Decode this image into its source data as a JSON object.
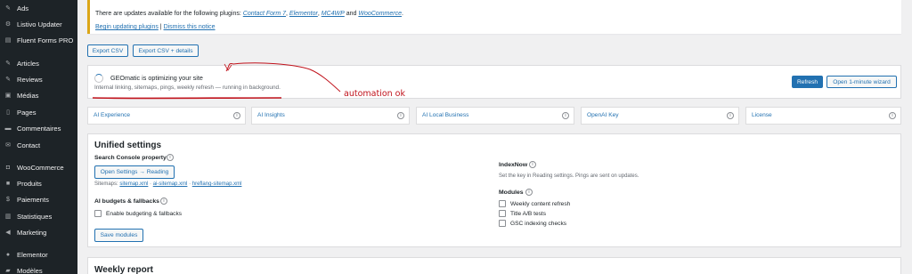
{
  "sidebar": {
    "items": [
      {
        "label": "Ads",
        "icon": "pin-icon"
      },
      {
        "label": "Listivo Updater",
        "icon": "gear-icon"
      },
      {
        "label": "Fluent Forms PRO",
        "icon": "forms-icon"
      },
      {
        "label": "Articles",
        "icon": "pin-icon"
      },
      {
        "label": "Reviews",
        "icon": "pin-icon"
      },
      {
        "label": "Médias",
        "icon": "media-icon"
      },
      {
        "label": "Pages",
        "icon": "page-icon"
      },
      {
        "label": "Commentaires",
        "icon": "comment-icon"
      },
      {
        "label": "Contact",
        "icon": "mail-icon"
      },
      {
        "label": "WooCommerce",
        "icon": "woo-icon"
      },
      {
        "label": "Produits",
        "icon": "box-icon"
      },
      {
        "label": "Paiements",
        "icon": "dollar-icon"
      },
      {
        "label": "Statistiques",
        "icon": "chart-icon"
      },
      {
        "label": "Marketing",
        "icon": "megaphone-icon"
      },
      {
        "label": "Elementor",
        "icon": "elementor-icon"
      },
      {
        "label": "Modèles",
        "icon": "folder-icon"
      }
    ]
  },
  "notice": {
    "text_prefix": "There are updates available for the following plugins: ",
    "plugins": [
      "Contact Form 7",
      "Elementor",
      "MC4WP",
      "WooCommerce"
    ],
    "sep1": ", ",
    "and": " and ",
    "period": ".",
    "begin_link": "Begin updating plugins",
    "pipe": " | ",
    "dismiss_link": "Dismiss this notice"
  },
  "export": {
    "csv_label": "Export CSV",
    "csv_details_label": "Export CSV + details"
  },
  "status": {
    "title": "GEOmatic is optimizing your site",
    "subtitle": "Internal linking, sitemaps, pings, weekly refresh — running in background.",
    "refresh_label": "Refresh",
    "wizard_label": "Open 1-minute wizard"
  },
  "tabs": [
    "AI Experience",
    "AI Insights",
    "AI Local Business",
    "OpenAI Key",
    "License"
  ],
  "info_glyph": "i",
  "settings": {
    "title": "Unified settings",
    "search_console_label": "Search Console property",
    "open_settings_label": "Open Settings → Reading",
    "sitemaps_prefix": "Sitemaps: ",
    "sitemap_links": [
      "sitemap.xml",
      "ai-sitemap.xml",
      "hreflang-sitemap.xml"
    ],
    "sitemap_sep": " · ",
    "budget_label": "AI budgets & fallbacks",
    "budget_checkbox": "Enable budgeting & fallbacks",
    "save_label": "Save modules",
    "indexnow_label": "IndexNow",
    "indexnow_text": "Set the key in Reading settings. Pings are sent on updates.",
    "modules_label": "Modules",
    "modules": [
      "Weekly content refresh",
      "Title A/B tests",
      "GSC indexing checks"
    ]
  },
  "weekly": {
    "title": "Weekly report"
  },
  "annotation": {
    "text": "automation ok",
    "color": "#c0121b"
  },
  "colors": {
    "sidebar_bg": "#1d2327",
    "accent": "#2271b1",
    "notice_border": "#dba617",
    "page_bg": "#f0f0f1"
  }
}
